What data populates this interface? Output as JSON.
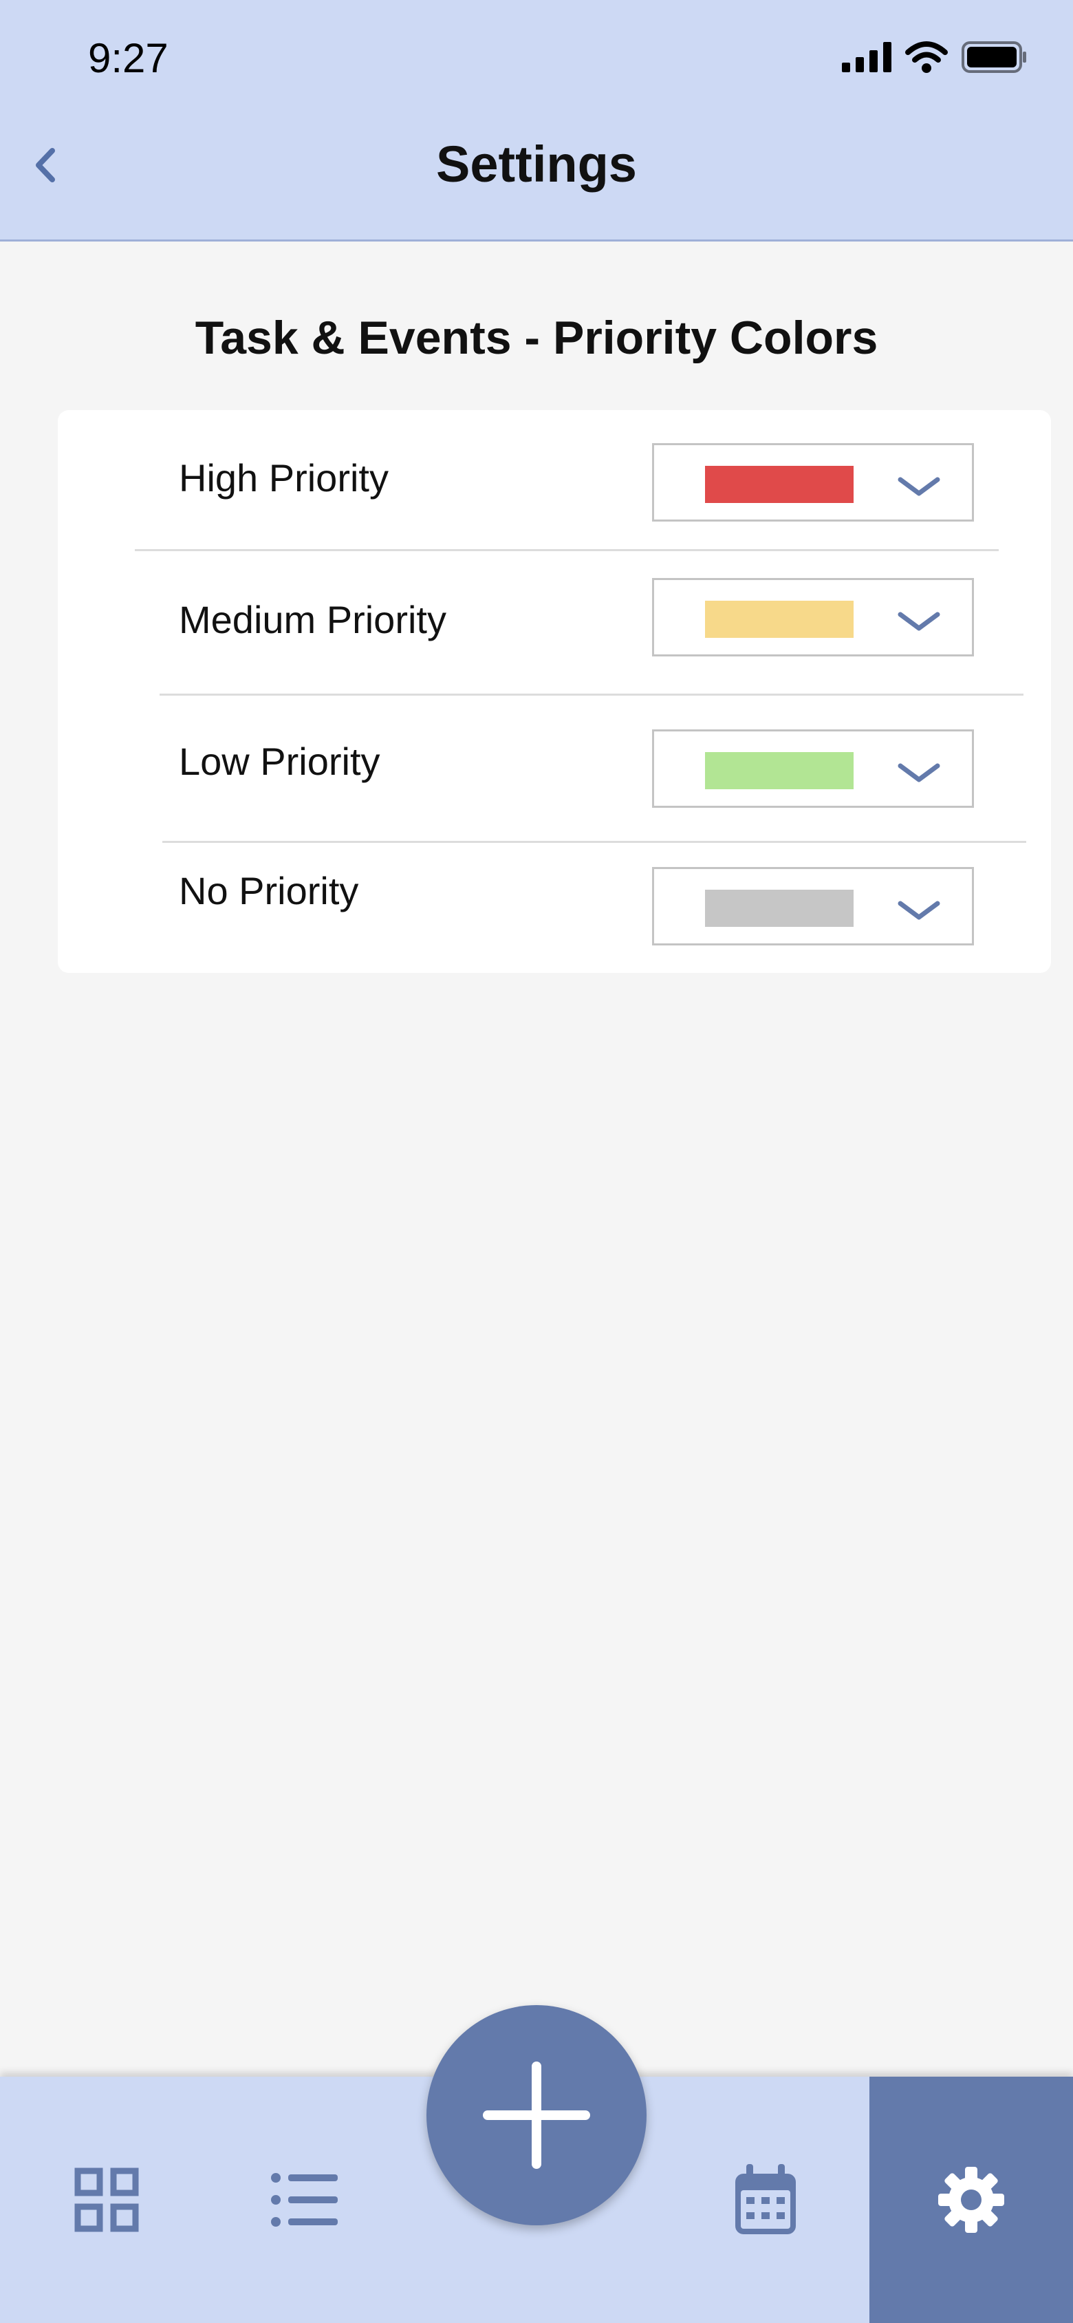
{
  "status_bar": {
    "time": "9:27"
  },
  "header": {
    "title": "Settings",
    "back_icon": "chevron-left-icon"
  },
  "section": {
    "title": "Task & Events - Priority Colors"
  },
  "priorities": [
    {
      "label": "High Priority",
      "color": "#e04a4a"
    },
    {
      "label": "Medium Priority",
      "color": "#f7d98a"
    },
    {
      "label": "Low Priority",
      "color": "#b2e594"
    },
    {
      "label": "No Priority",
      "color": "#c6c6c6"
    }
  ],
  "bottom_nav": {
    "items": [
      {
        "icon": "dashboard-grid-icon"
      },
      {
        "icon": "list-icon"
      },
      {
        "icon": "add-icon"
      },
      {
        "icon": "calendar-icon"
      },
      {
        "icon": "gear-icon",
        "active": true
      }
    ]
  },
  "colors": {
    "header_bg": "#cdd9f4",
    "accent": "#637aab",
    "background": "#f5f5f5"
  }
}
